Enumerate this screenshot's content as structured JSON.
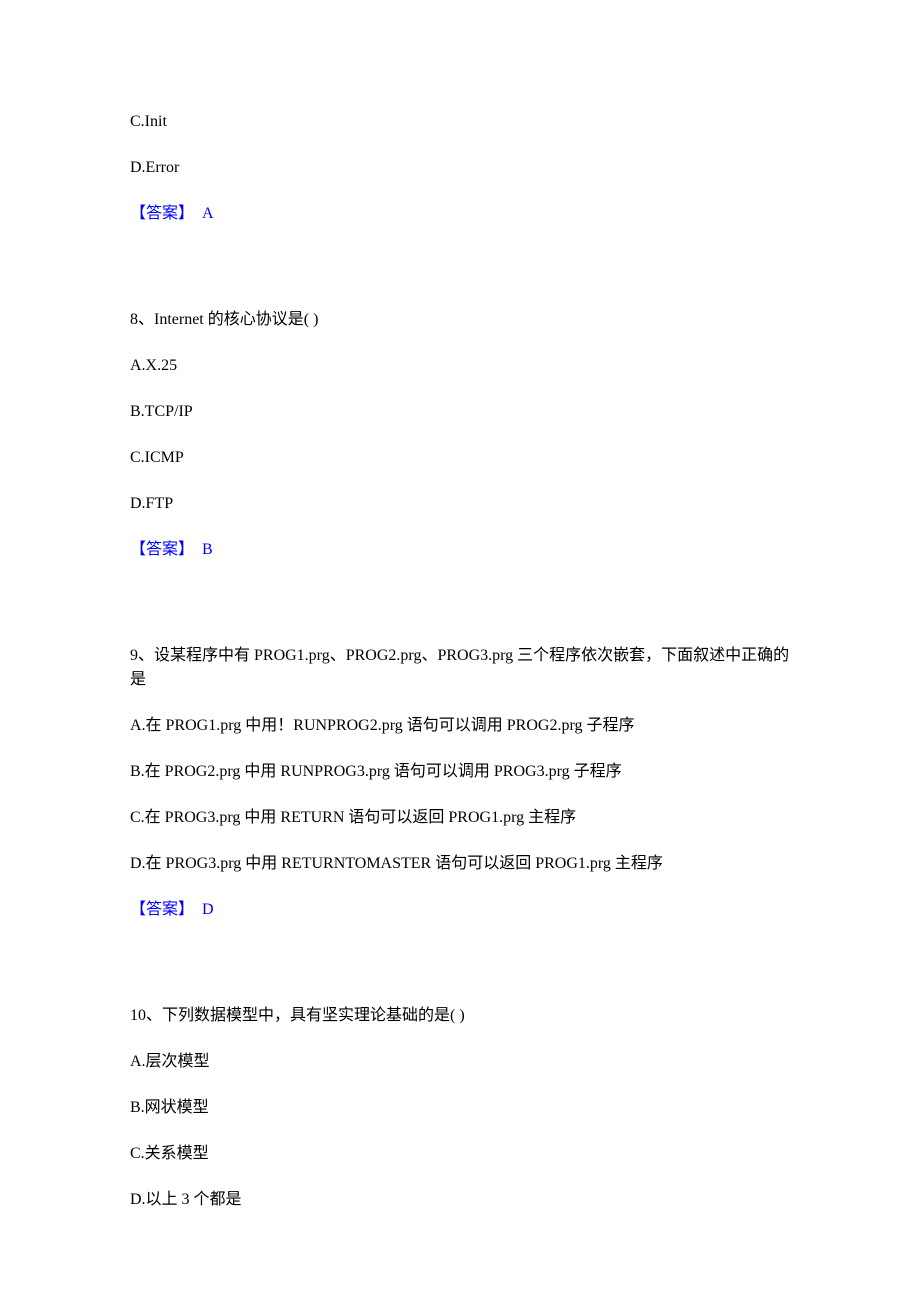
{
  "q7": {
    "optionC": "C.Init",
    "optionD": "D.Error",
    "answerLabel": "【答案】",
    "answerLetter": "A"
  },
  "q8": {
    "text": "8、Internet 的核心协议是( )",
    "optionA": "A.X.25",
    "optionB": "B.TCP/IP",
    "optionC": "C.ICMP",
    "optionD": "D.FTP",
    "answerLabel": "【答案】",
    "answerLetter": "B"
  },
  "q9": {
    "text": "9、设某程序中有 PROG1.prg、PROG2.prg、PROG3.prg 三个程序依次嵌套，下面叙述中正确的是",
    "optionA": "A.在 PROG1.prg 中用！RUNPROG2.prg 语句可以调用 PROG2.prg 子程序",
    "optionB": "B.在 PROG2.prg 中用 RUNPROG3.prg 语句可以调用 PROG3.prg 子程序",
    "optionC": "C.在 PROG3.prg 中用 RETURN 语句可以返回 PROG1.prg 主程序",
    "optionD": "D.在 PROG3.prg 中用 RETURNTOMASTER 语句可以返回 PROG1.prg 主程序",
    "answerLabel": "【答案】",
    "answerLetter": "D"
  },
  "q10": {
    "text": "10、下列数据模型中，具有坚实理论基础的是( )",
    "optionA": "A.层次模型",
    "optionB": "B.网状模型",
    "optionC": "C.关系模型",
    "optionD": "D.以上 3 个都是"
  }
}
